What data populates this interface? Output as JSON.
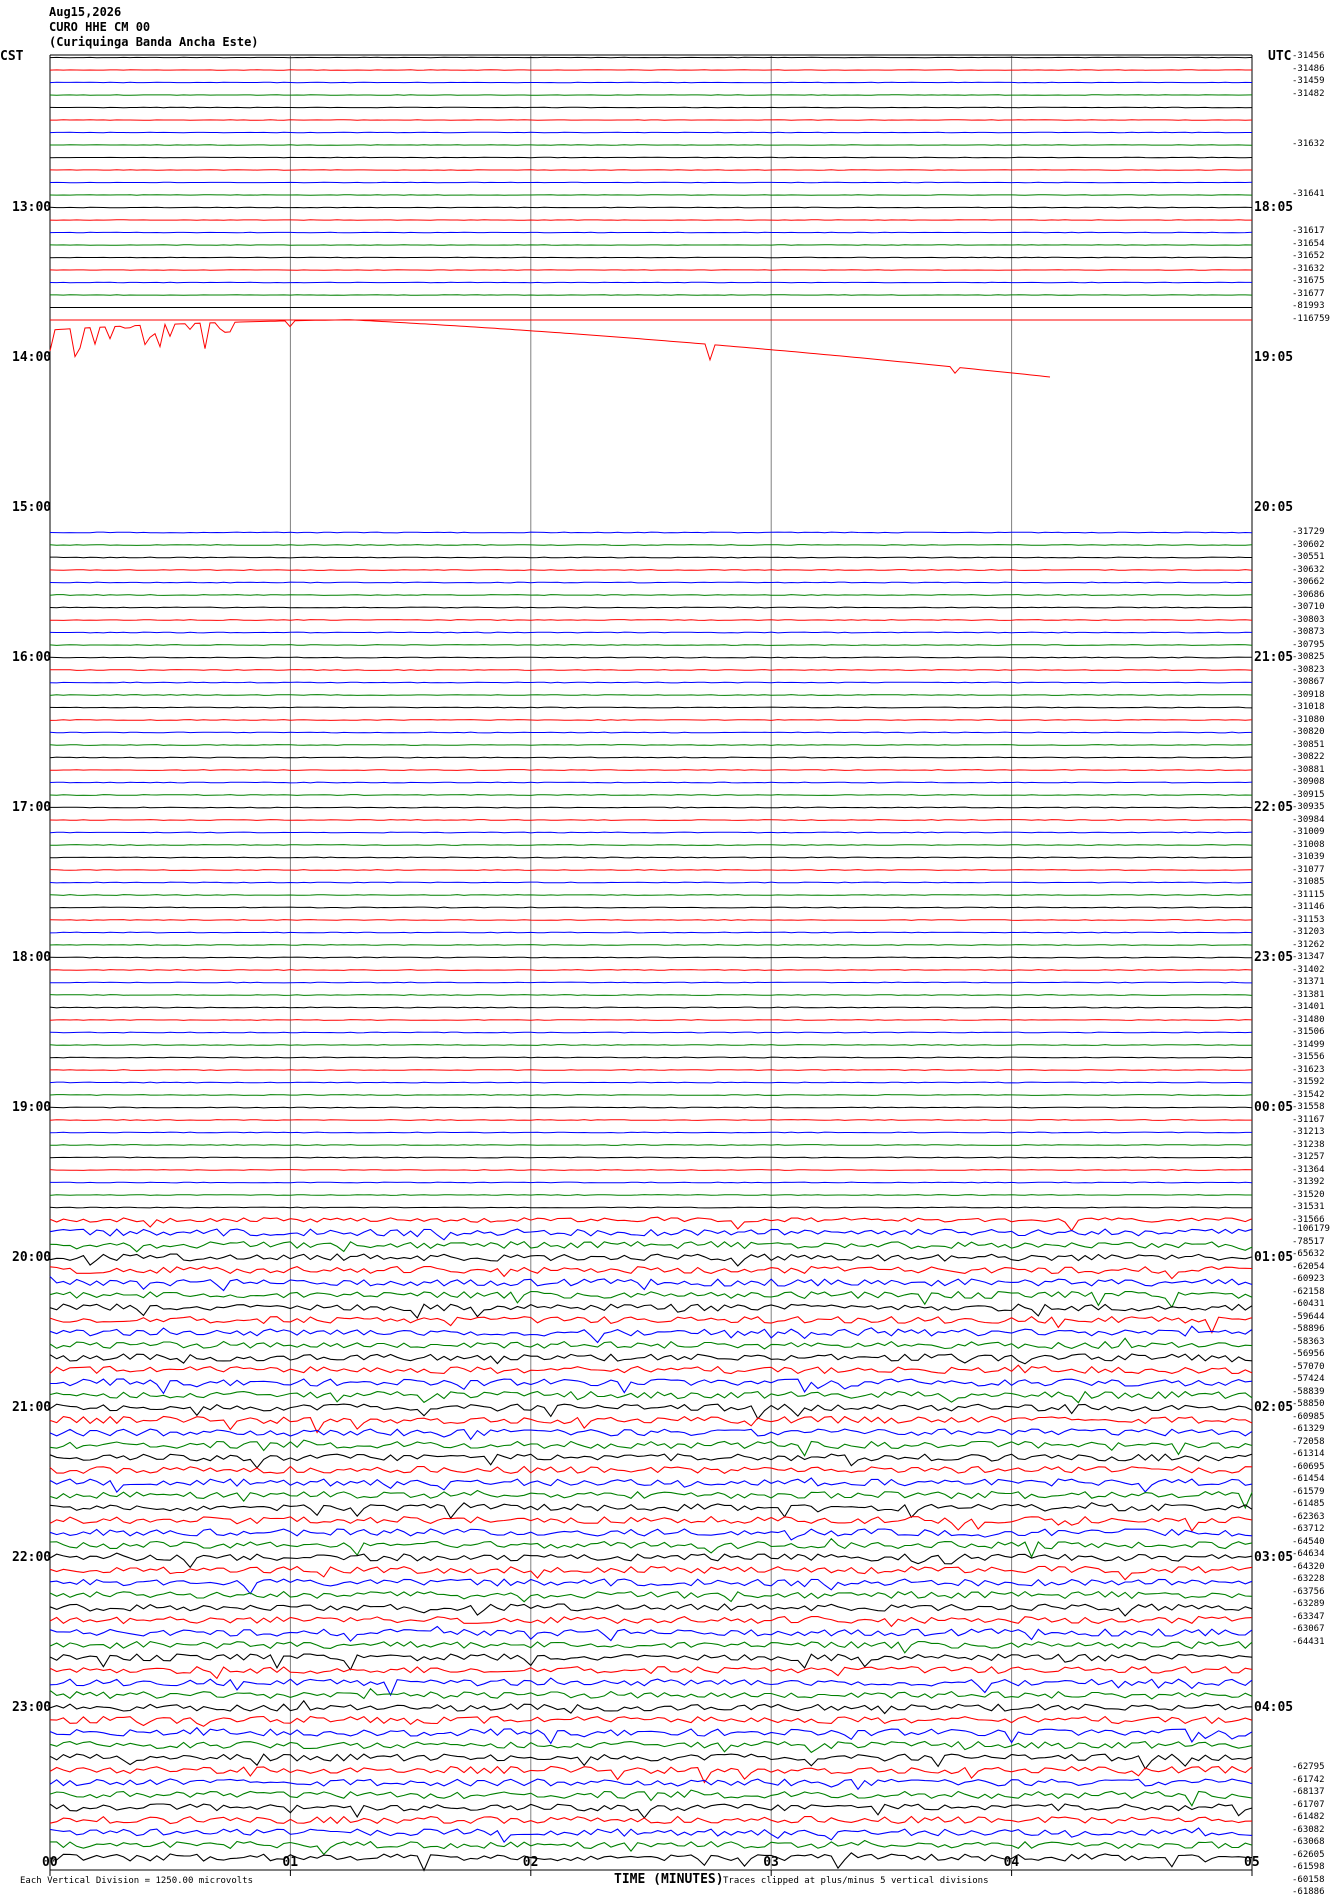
{
  "header": {
    "date": "Aug15,2026",
    "station": "CURO HHE CM 00",
    "name": "(Curiquinga Banda Ancha Este)"
  },
  "axis_left_title": "CST",
  "axis_right_title": "UTC",
  "colors": {
    "black": "#000000",
    "red": "#ff0000",
    "blue": "#0000ff",
    "green": "#008000",
    "grid": "#808080"
  },
  "chart_data": {
    "type": "line",
    "title": "",
    "xlabel": "TIME (MINUTES)",
    "ylabel": "",
    "xlim": [
      0,
      5
    ],
    "x_ticks": [
      "00",
      "01",
      "02",
      "03",
      "04",
      "05"
    ],
    "left_time_labels": [
      "13:00",
      "14:00",
      "15:00",
      "16:00",
      "17:00",
      "18:00",
      "19:00",
      "20:00",
      "21:00",
      "22:00",
      "23:00"
    ],
    "right_time_labels": [
      "18:05",
      "19:05",
      "20:05",
      "21:05",
      "22:05",
      "23:05",
      "00:05",
      "01:05",
      "02:05",
      "03:05",
      "04:05"
    ],
    "grid": true,
    "trace_color_cycle": [
      "black",
      "red",
      "blue",
      "green"
    ],
    "right_value_labels": [
      "-31456",
      "-31486",
      "-31459",
      "-31482",
      "-31632",
      "-31641",
      "-31617",
      "-31654",
      "-31652",
      "-31632",
      "-31675",
      "-31677",
      "-81993",
      "-116759",
      "-31729",
      "-30602",
      "-30551",
      "-30632",
      "-30662",
      "-30686",
      "-30710",
      "-30803",
      "-30873",
      "-30795",
      "-30825",
      "-30823",
      "-30867",
      "-30918",
      "-31018",
      "-31080",
      "-30820",
      "-30851",
      "-30822",
      "-30881",
      "-30908",
      "-30915",
      "-30935",
      "-30984",
      "-31009",
      "-31008",
      "-31039",
      "-31077",
      "-31085",
      "-31115",
      "-31146",
      "-31153",
      "-31203",
      "-31262",
      "-31347",
      "-31402",
      "-31371",
      "-31381",
      "-31401",
      "-31480",
      "-31506",
      "-31499",
      "-31556",
      "-31623",
      "-31592",
      "-31542",
      "-31558",
      "-31167",
      "-31213",
      "-31238",
      "-31257",
      "-31364",
      "-31392",
      "-31520",
      "-31531",
      "-31566",
      "-106179",
      "-78517",
      "-65632",
      "-62054",
      "-60923",
      "-62158",
      "-60431",
      "-59644",
      "-58896",
      "-58363",
      "-56956",
      "-57070",
      "-57424",
      "-58839",
      "-58850",
      "-60985",
      "-61329",
      "-72058",
      "-61314",
      "-60695",
      "-61454",
      "-61579",
      "-61485",
      "-62363",
      "-63712",
      "-64540",
      "-64634",
      "-64320",
      "-63228",
      "-63756",
      "-63289",
      "-63347",
      "-63067",
      "-64431",
      "-62795",
      "-61742",
      "-68137",
      "-61707",
      "-61482",
      "-63082",
      "-63068",
      "-62605",
      "-61598",
      "-60158",
      "-61886"
    ],
    "footer_note_left": "Each Vertical Division = 1250.00 microvolts",
    "footer_note_right": "Traces clipped at plus/minus 5 vertical divisions"
  }
}
